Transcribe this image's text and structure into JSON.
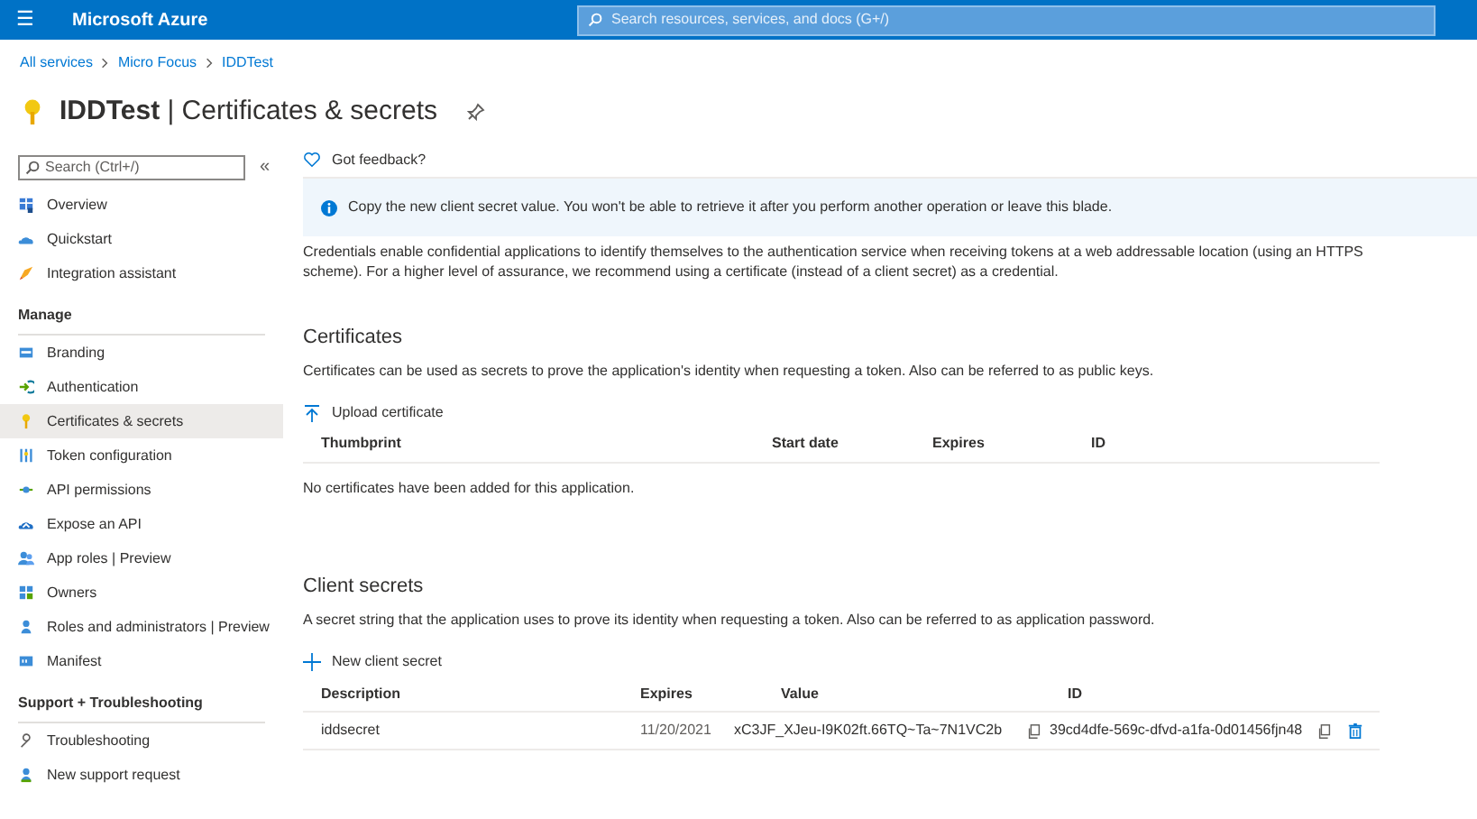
{
  "top_bar": {
    "menu_glyph": "☰",
    "brand": "Microsoft Azure",
    "search": {
      "placeholder": "Search resources, services, and docs (G+/)"
    }
  },
  "breadcrumb": [
    "All services",
    "Micro Focus",
    "IDDTest"
  ],
  "page_title": {
    "resource": "IDDTest",
    "separator": "|",
    "section": "Certificates & secrets"
  },
  "sidebar": {
    "search": {
      "placeholder": "Search (Ctrl+/)"
    },
    "collapse_glyph": "«",
    "groups": [
      {
        "items": [
          {
            "label": "Overview",
            "selected": false
          },
          {
            "label": "Quickstart",
            "selected": false
          },
          {
            "label": "Integration assistant",
            "selected": false
          }
        ]
      },
      {
        "heading": "Manage",
        "items": [
          {
            "label": "Branding",
            "selected": false
          },
          {
            "label": "Authentication",
            "selected": false
          },
          {
            "label": "Certificates & secrets",
            "selected": true
          },
          {
            "label": "Token configuration",
            "selected": false
          },
          {
            "label": "API permissions",
            "selected": false
          },
          {
            "label": "Expose an API",
            "selected": false
          },
          {
            "label": "App roles | Preview",
            "selected": false
          },
          {
            "label": "Owners",
            "selected": false
          },
          {
            "label": "Roles and administrators | Preview",
            "selected": false
          },
          {
            "label": "Manifest",
            "selected": false
          }
        ]
      },
      {
        "heading": "Support + Troubleshooting",
        "items": [
          {
            "label": "Troubleshooting",
            "selected": false
          },
          {
            "label": "New support request",
            "selected": false
          }
        ]
      }
    ]
  },
  "feedback": "Got feedback?",
  "info_banner": "Copy the new client secret value. You won't be able to retrieve it after you perform another operation or leave this blade.",
  "intro": "Credentials enable confidential applications to identify themselves to the authentication service when receiving tokens at a web addressable location (using an HTTPS scheme). For a higher level of assurance, we recommend using a certificate (instead of a client secret) as a credential.",
  "certificates": {
    "title": "Certificates",
    "description": "Certificates can be used as secrets to prove the application's identity when requesting a token. Also can be referred to as public keys.",
    "action": "Upload certificate",
    "columns": [
      "Thumbprint",
      "Start date",
      "Expires",
      "ID"
    ],
    "empty_text": "No certificates have been added for this application."
  },
  "client_secrets": {
    "title": "Client secrets",
    "description": "A secret string that the application uses to prove its identity when requesting a token. Also can be referred to as application password.",
    "action": "New client secret",
    "columns": [
      "Description",
      "Expires",
      "Value",
      "ID"
    ],
    "rows": [
      {
        "description": "iddsecret",
        "expires": "11/20/2021",
        "value": "xC3JF_XJeu-I9K02ft.66TQ~Ta~7N1VC2b",
        "id": "39cd4dfe-569c-dfvd-a1fa-0d01456fjn48"
      }
    ]
  }
}
